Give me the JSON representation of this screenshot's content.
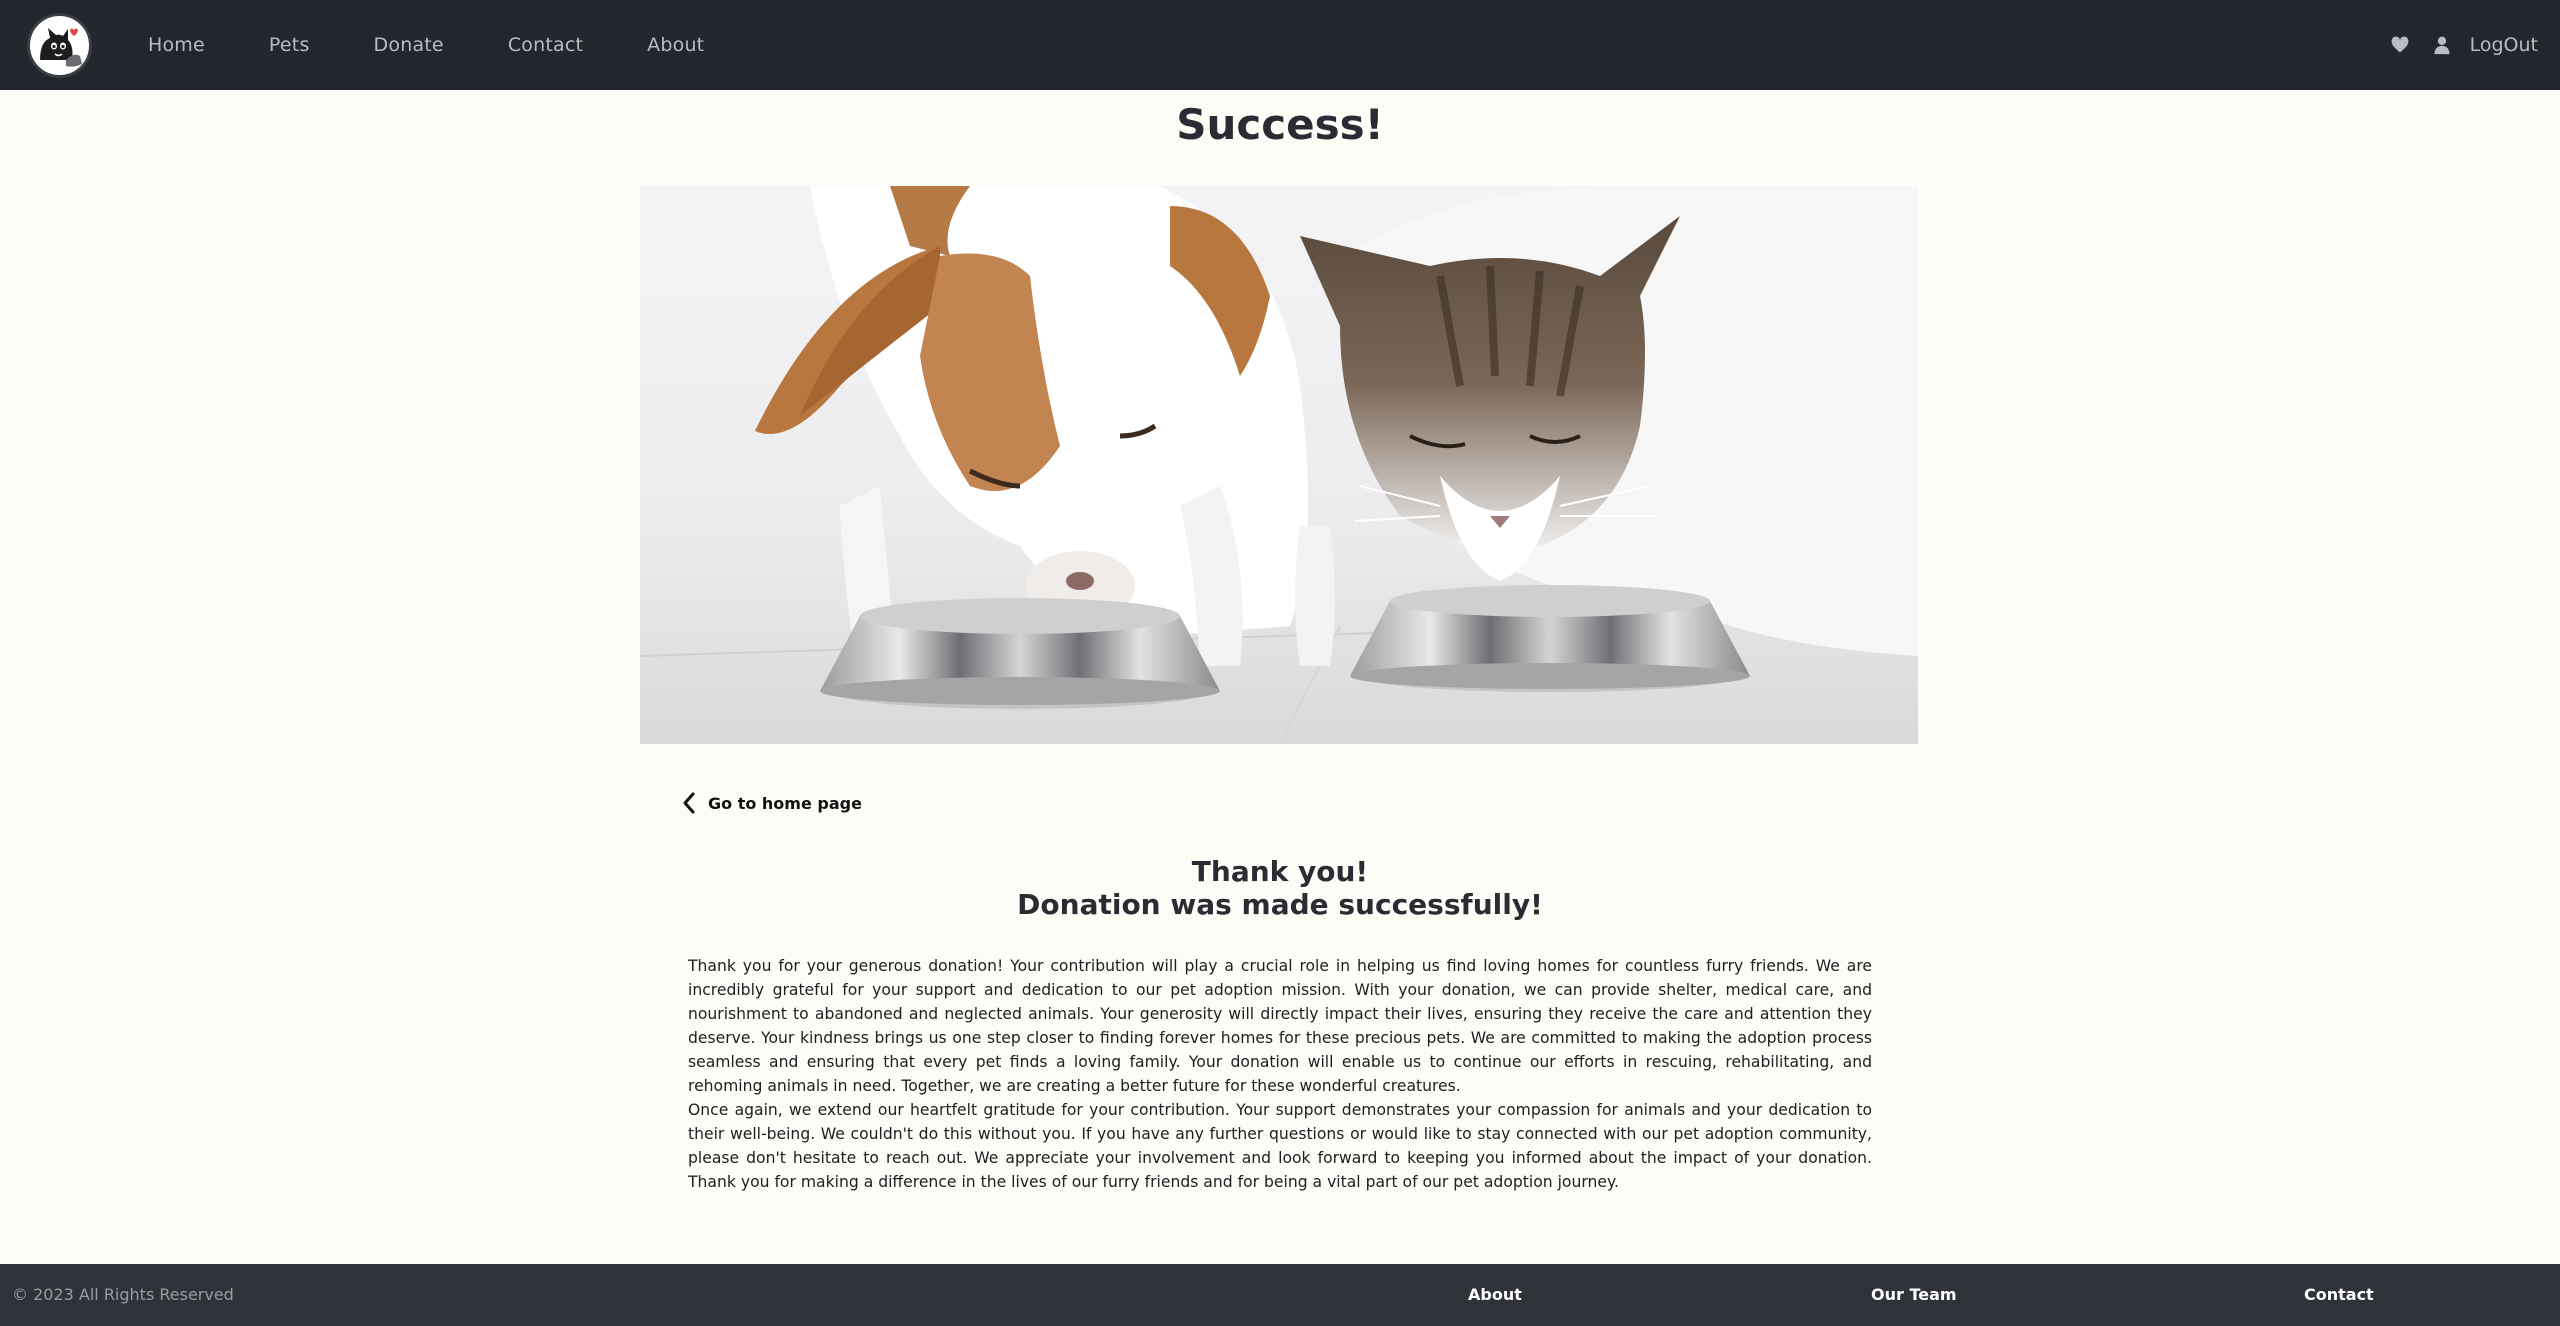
{
  "nav": {
    "items": [
      {
        "label": "Home"
      },
      {
        "label": "Pets"
      },
      {
        "label": "Donate"
      },
      {
        "label": "Contact"
      },
      {
        "label": "About"
      }
    ],
    "logout_label": "LogOut",
    "icons": {
      "favorites": "heart-icon",
      "account": "user-icon"
    }
  },
  "page": {
    "title": "Success!",
    "hero_image": "dog and cat eating from metal bowls",
    "back_link": "Go to home page",
    "thanks_line1": "Thank you!",
    "thanks_line2": "Donation was made successfully!",
    "paragraph1": "Thank you for your generous donation! Your contribution will play a crucial role in helping us find loving homes for countless furry friends. We are incredibly grateful for your support and dedication to our pet adoption mission. With your donation, we can provide shelter, medical care, and nourishment to abandoned and neglected animals. Your generosity will directly impact their lives, ensuring they receive the care and attention they deserve. Your kindness brings us one step closer to finding forever homes for these precious pets. We are committed to making the adoption process seamless and ensuring that every pet finds a loving family. Your donation will enable us to continue our efforts in rescuing, rehabilitating, and rehoming animals in need. Together, we are creating a better future for these wonderful creatures.",
    "paragraph2": "Once again, we extend our heartfelt gratitude for your contribution. Your support demonstrates your compassion for animals and your dedication to their well-being. We couldn't do this without you. If you have any further questions or would like to stay connected with our pet adoption community, please don't hesitate to reach out. We appreciate your involvement and look forward to keeping you informed about the impact of your donation. Thank you for making a difference in the lives of our furry friends and for being a vital part of our pet adoption journey."
  },
  "footer": {
    "copyright": "© 2023 All Rights Reserved",
    "links": [
      {
        "label": "About"
      },
      {
        "label": "Our Team"
      },
      {
        "label": "Contact"
      }
    ]
  },
  "colors": {
    "header_bg": "#22262d",
    "page_bg": "#fdfdf8",
    "footer_bg": "#2f3238",
    "heading": "#2b2b33"
  }
}
